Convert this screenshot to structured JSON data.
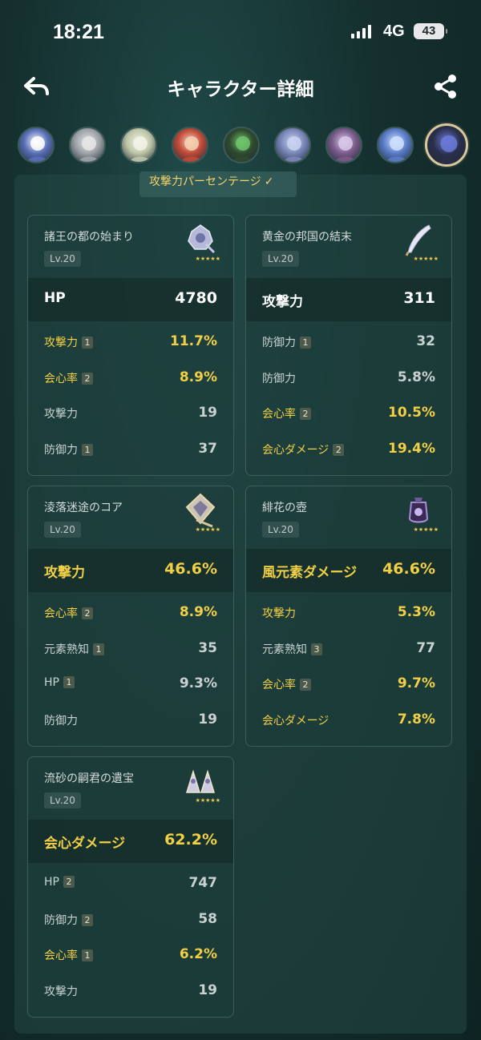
{
  "status_bar": {
    "time": "18:21",
    "network": "4G",
    "battery": "43"
  },
  "header": {
    "title": "キャラクター詳細"
  },
  "colors": {
    "accent_gold": "#f2cf45",
    "background": "#15302f",
    "card_bg": "#1c3c3a"
  },
  "avatars": [
    {
      "name": "avatar-1",
      "color": "#5a6fb8",
      "accent": "#ffffff"
    },
    {
      "name": "avatar-2",
      "color": "#9fa4a8",
      "accent": "#e6e6e6"
    },
    {
      "name": "avatar-3",
      "color": "#bfc6a8",
      "accent": "#f2f2e6"
    },
    {
      "name": "avatar-4",
      "color": "#c04a38",
      "accent": "#f4d2b5"
    },
    {
      "name": "avatar-5",
      "color": "#2f4a2e",
      "accent": "#6fc36b"
    },
    {
      "name": "avatar-6",
      "color": "#7a86b8",
      "accent": "#c9d3f0"
    },
    {
      "name": "avatar-7",
      "color": "#7a5a8a",
      "accent": "#d9c8e8"
    },
    {
      "name": "avatar-8",
      "color": "#5a7cc8",
      "accent": "#cfe0ff"
    },
    {
      "name": "avatar-9",
      "color": "#2a2f4a",
      "accent": "#6a7ad8",
      "selected": true
    }
  ],
  "filter_tab": {
    "label": "攻撃力パーセンテージ",
    "check": "✓"
  },
  "artifacts": [
    {
      "name": "諸王の都の始まり",
      "level": "Lv.20",
      "stars": "★★★★★",
      "icon": "flower-artifact-icon",
      "main": {
        "label": "HP",
        "value": "4780",
        "highlight": false
      },
      "subs": [
        {
          "label": "攻撃力",
          "badge": "1",
          "value": "11.7%",
          "highlight": true
        },
        {
          "label": "会心率",
          "badge": "2",
          "value": "8.9%",
          "highlight": true
        },
        {
          "label": "攻撃力",
          "badge": "",
          "value": "19",
          "highlight": false
        },
        {
          "label": "防御力",
          "badge": "1",
          "value": "37",
          "highlight": false
        }
      ]
    },
    {
      "name": "黄金の邦国の結末",
      "level": "Lv.20",
      "stars": "★★★★★",
      "icon": "plume-artifact-icon",
      "main": {
        "label": "攻撃力",
        "value": "311",
        "highlight": false
      },
      "subs": [
        {
          "label": "防御力",
          "badge": "1",
          "value": "32",
          "highlight": false
        },
        {
          "label": "防御力",
          "badge": "",
          "value": "5.8%",
          "highlight": false
        },
        {
          "label": "会心率",
          "badge": "2",
          "value": "10.5%",
          "highlight": true
        },
        {
          "label": "会心ダメージ",
          "badge": "2",
          "value": "19.4%",
          "highlight": true
        }
      ]
    },
    {
      "name": "淩落迷途のコア",
      "level": "Lv.20",
      "stars": "★★★★★",
      "icon": "sands-artifact-icon",
      "main": {
        "label": "攻撃力",
        "value": "46.6%",
        "highlight": true
      },
      "subs": [
        {
          "label": "会心率",
          "badge": "2",
          "value": "8.9%",
          "highlight": true
        },
        {
          "label": "元素熟知",
          "badge": "1",
          "value": "35",
          "highlight": false
        },
        {
          "label": "HP",
          "badge": "1",
          "value": "9.3%",
          "highlight": false
        },
        {
          "label": "防御力",
          "badge": "",
          "value": "19",
          "highlight": false
        }
      ]
    },
    {
      "name": "緋花の壺",
      "level": "Lv.20",
      "stars": "★★★★★",
      "icon": "goblet-artifact-icon",
      "main": {
        "label": "風元素ダメージ",
        "value": "46.6%",
        "highlight": true
      },
      "subs": [
        {
          "label": "攻撃力",
          "badge": "",
          "value": "5.3%",
          "highlight": true
        },
        {
          "label": "元素熟知",
          "badge": "3",
          "value": "77",
          "highlight": false
        },
        {
          "label": "会心率",
          "badge": "2",
          "value": "9.7%",
          "highlight": true
        },
        {
          "label": "会心ダメージ",
          "badge": "",
          "value": "7.8%",
          "highlight": true
        }
      ]
    },
    {
      "name": "流砂の嗣君の遺宝",
      "level": "Lv.20",
      "stars": "★★★★★",
      "icon": "circlet-artifact-icon",
      "main": {
        "label": "会心ダメージ",
        "value": "62.2%",
        "highlight": true
      },
      "subs": [
        {
          "label": "HP",
          "badge": "2",
          "value": "747",
          "highlight": false
        },
        {
          "label": "防御力",
          "badge": "2",
          "value": "58",
          "highlight": false
        },
        {
          "label": "会心率",
          "badge": "1",
          "value": "6.2%",
          "highlight": true
        },
        {
          "label": "攻撃力",
          "badge": "",
          "value": "19",
          "highlight": false
        }
      ]
    }
  ]
}
